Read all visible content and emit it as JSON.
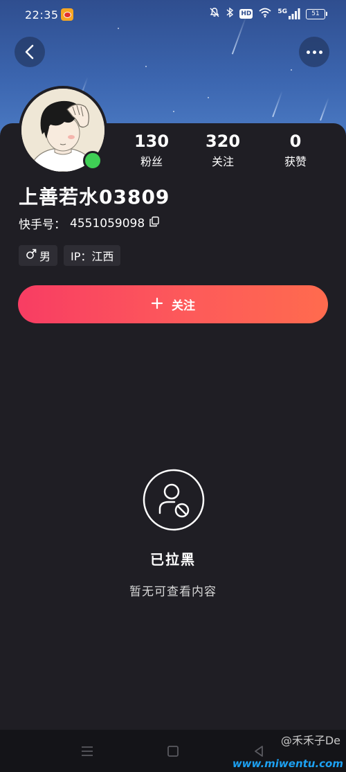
{
  "status_bar": {
    "time": "22:35",
    "hd": "HD",
    "network": "5G",
    "battery": "51"
  },
  "profile": {
    "username": "上善若水03809",
    "user_id_label": "快手号：",
    "user_id": "4551059098",
    "stats": [
      {
        "value": "130",
        "label": "粉丝"
      },
      {
        "value": "320",
        "label": "关注"
      },
      {
        "value": "0",
        "label": "获赞"
      }
    ],
    "tags": {
      "gender": "男",
      "ip": "IP：江西"
    },
    "online": true
  },
  "follow_button": {
    "label": "关注"
  },
  "blocked_state": {
    "title": "已拉黑",
    "subtitle": "暂无可查看内容"
  },
  "watermark": {
    "handle": "@禾禾子De",
    "url": "www.miwentu.com"
  },
  "colors": {
    "background": "#1f1e24",
    "follow_gradient_start": "#f83d63",
    "follow_gradient_end": "#ff6b4e",
    "online": "#3fcf55",
    "tag_bg": "#2e2d34"
  },
  "icons": {
    "back": "chevron-left-icon",
    "more": "more-dots-icon",
    "copy": "copy-icon",
    "male": "male-icon",
    "plus": "plus-icon",
    "blocked": "user-blocked-icon"
  }
}
